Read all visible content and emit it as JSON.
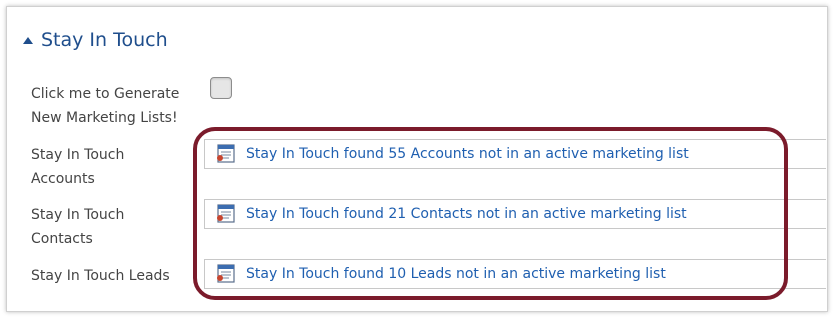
{
  "section": {
    "title": "Stay In Touch"
  },
  "fields": {
    "generate": {
      "label_line1": "Click me to Generate",
      "label_line2": "New Marketing Lists!"
    },
    "accounts": {
      "label_line1": "Stay In Touch",
      "label_line2": "Accounts",
      "link": "Stay In Touch found 55 Accounts not in an active marketing list",
      "icon": "record-list-icon"
    },
    "contacts": {
      "label_line1": "Stay In Touch",
      "label_line2": "Contacts",
      "link": "Stay In Touch found 21 Contacts not in an active marketing list",
      "icon": "record-list-icon"
    },
    "leads": {
      "label_line1": "Stay In Touch Leads",
      "link": "Stay In Touch found 10 Leads not in an active marketing list",
      "icon": "record-list-icon"
    }
  },
  "colors": {
    "accent": "#1f4e8c",
    "link": "#1f5fb0",
    "highlight": "#7b1b2b"
  }
}
